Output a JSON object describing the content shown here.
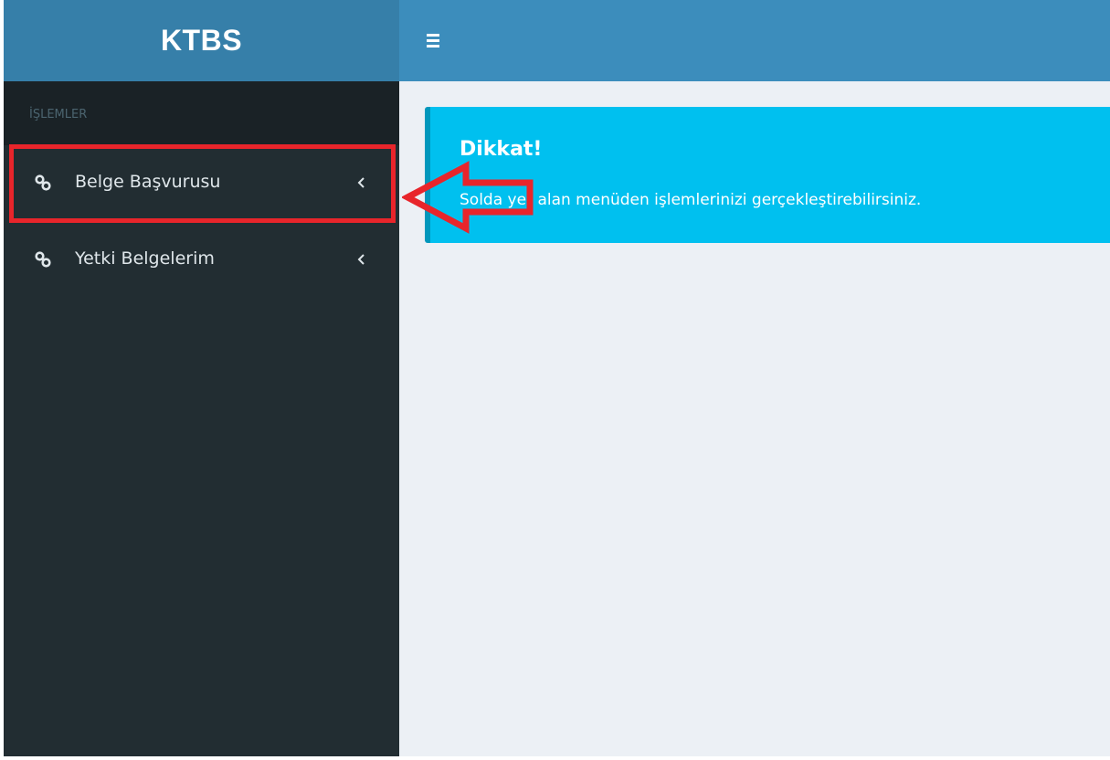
{
  "brand": {
    "title": "KTBS"
  },
  "topbar": {
    "menu_icon": "hamburger-icon"
  },
  "sidebar": {
    "section_header": "İŞLEMLER",
    "items": [
      {
        "label": "Belge Başvurusu",
        "icon": "link-icon",
        "chevron": "chevron-left-icon"
      },
      {
        "label": "Yetki Belgelerim",
        "icon": "link-icon",
        "chevron": "chevron-left-icon"
      }
    ]
  },
  "alert": {
    "title": "Dikkat!",
    "message": "Solda yer alan menüden işlemlerinizi gerçekleştirebilirsiniz."
  },
  "annotations": {
    "highlight_color": "#e8252b"
  },
  "colors": {
    "topbar": "#3c8dbc",
    "brand_bar": "#367fa9",
    "sidebar": "#222d32",
    "sidebar_header": "#1a2226",
    "content_bg": "#ecf0f5",
    "alert_bg": "#00c0ef",
    "alert_border": "#0097bc"
  }
}
